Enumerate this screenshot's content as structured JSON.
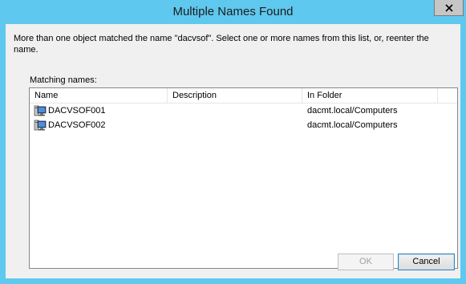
{
  "window": {
    "title": "Multiple Names Found"
  },
  "message": "More than one object matched the name \"dacvsof\". Select one or more names from this list, or, reenter the name.",
  "list": {
    "label": "Matching names:",
    "columns": [
      "Name",
      "Description",
      "In Folder"
    ],
    "rows": [
      {
        "name": "DACVSOF001",
        "description": "",
        "folder": "dacmt.local/Computers",
        "icon": "computer-icon"
      },
      {
        "name": "DACVSOF002",
        "description": "",
        "folder": "dacmt.local/Computers",
        "icon": "computer-icon"
      }
    ]
  },
  "buttons": {
    "ok": "OK",
    "cancel": "Cancel"
  },
  "colors": {
    "frame": "#5fc8ee",
    "client": "#f0f0f0",
    "cancel_border": "#3c7fb1"
  }
}
